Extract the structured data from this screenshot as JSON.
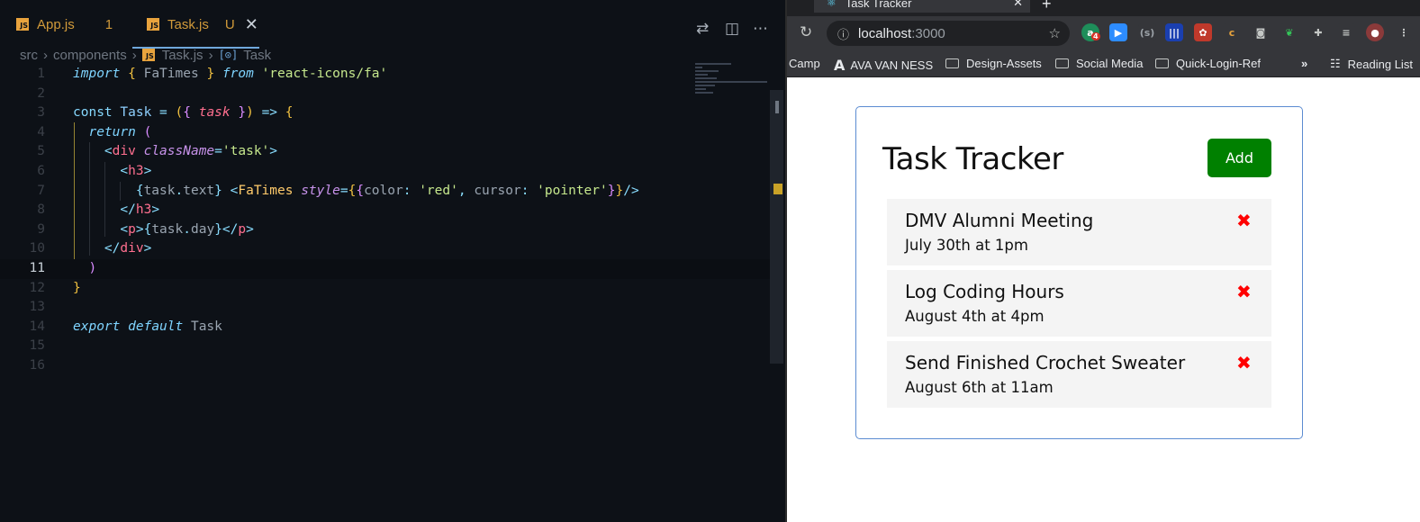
{
  "editor": {
    "tabs": [
      {
        "icon": "JS",
        "label": "App.js",
        "badge": "1"
      },
      {
        "icon": "JS",
        "label": "Task.js",
        "badge": "U",
        "close": "✕"
      }
    ],
    "breadcrumb": [
      "src",
      "components",
      "Task.js",
      "Task"
    ],
    "line_numbers": [
      "1",
      "2",
      "3",
      "4",
      "5",
      "6",
      "7",
      "8",
      "9",
      "10",
      "11",
      "12",
      "13",
      "14",
      "15",
      "16"
    ],
    "active_line": "11"
  },
  "browser": {
    "tab_title": "Task Tracker",
    "new_tab": "+",
    "url_host": "localhost",
    "url_port": ":3000",
    "extension_badge": "4",
    "bookmarks": [
      "Camp",
      "AVA VAN NESS",
      "Design-Assets",
      "Social Media",
      "Quick-Login-Ref",
      "»",
      "Reading List"
    ]
  },
  "app": {
    "title": "Task Tracker",
    "add_label": "Add",
    "delete_glyph": "✖",
    "tasks": [
      {
        "text": "DMV Alumni Meeting",
        "day": "July 30th at 1pm"
      },
      {
        "text": "Log Coding Hours",
        "day": "August 4th at 4pm"
      },
      {
        "text": "Send Finished Crochet Sweater",
        "day": "August 6th at 11am"
      }
    ]
  },
  "colors": {
    "add_button": "#008000",
    "delete_icon": "#ff0000",
    "container_border": "#5b8bd1"
  }
}
